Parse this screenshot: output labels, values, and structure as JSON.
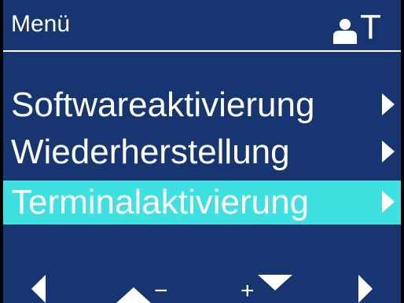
{
  "header": {
    "title": "Menü",
    "user_icon": "user-icon",
    "mode_label": "T"
  },
  "menu": {
    "items": [
      {
        "label": "Softwareaktivierung",
        "icon": "chevron-right-icon",
        "selected": false
      },
      {
        "label": "Wiederherstellung",
        "icon": "chevron-right-icon",
        "selected": false
      },
      {
        "label": "Terminalaktivierung",
        "icon": "chevron-right-icon",
        "selected": true
      }
    ]
  },
  "footer": {
    "softkeys": [
      {
        "icon": "triangle-left-icon"
      },
      {
        "icon": "triangle-up-icon",
        "symbol": "−"
      },
      {
        "icon": "triangle-down-icon",
        "symbol": "+"
      },
      {
        "icon": "triangle-right-icon"
      }
    ]
  },
  "colors": {
    "background": "#173570",
    "text": "#ffffff",
    "selection": "#3fe0e0"
  }
}
